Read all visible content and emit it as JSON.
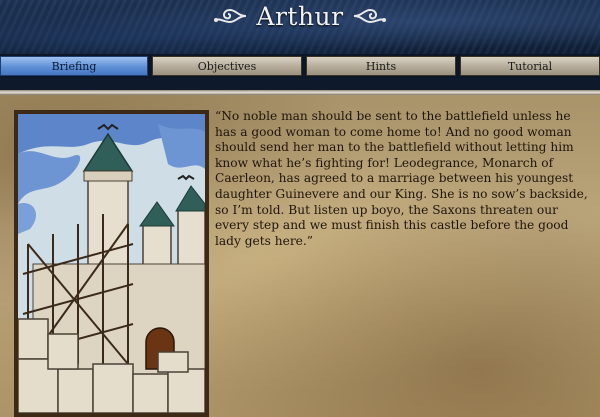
{
  "header": {
    "title": "Arthur"
  },
  "tabs": [
    {
      "label": "Briefing",
      "active": true
    },
    {
      "label": "Objectives",
      "active": false
    },
    {
      "label": "Hints",
      "active": false
    },
    {
      "label": "Tutorial",
      "active": false
    }
  ],
  "briefing": {
    "text": "“No noble man should be sent to the battlefield unless he has a good woman to come home to! And no good woman should send her man to the battlefield without letting him know what he’s fighting for! Leodegrance, Monarch of Caerleon, has agreed to a marriage between his youngest daughter Guinevere and our King. She is no sow’s backside, so I’m told. But listen up boyo, the Saxons threaten our every step and we must finish this castle before the good lady gets here.”",
    "illustration": "castle-under-construction"
  },
  "colors": {
    "active_tab": "#5f90d6",
    "tab": "#b4ab99",
    "parchment": "#bba57a",
    "header": "#1d3456",
    "text": "#1e150b"
  }
}
